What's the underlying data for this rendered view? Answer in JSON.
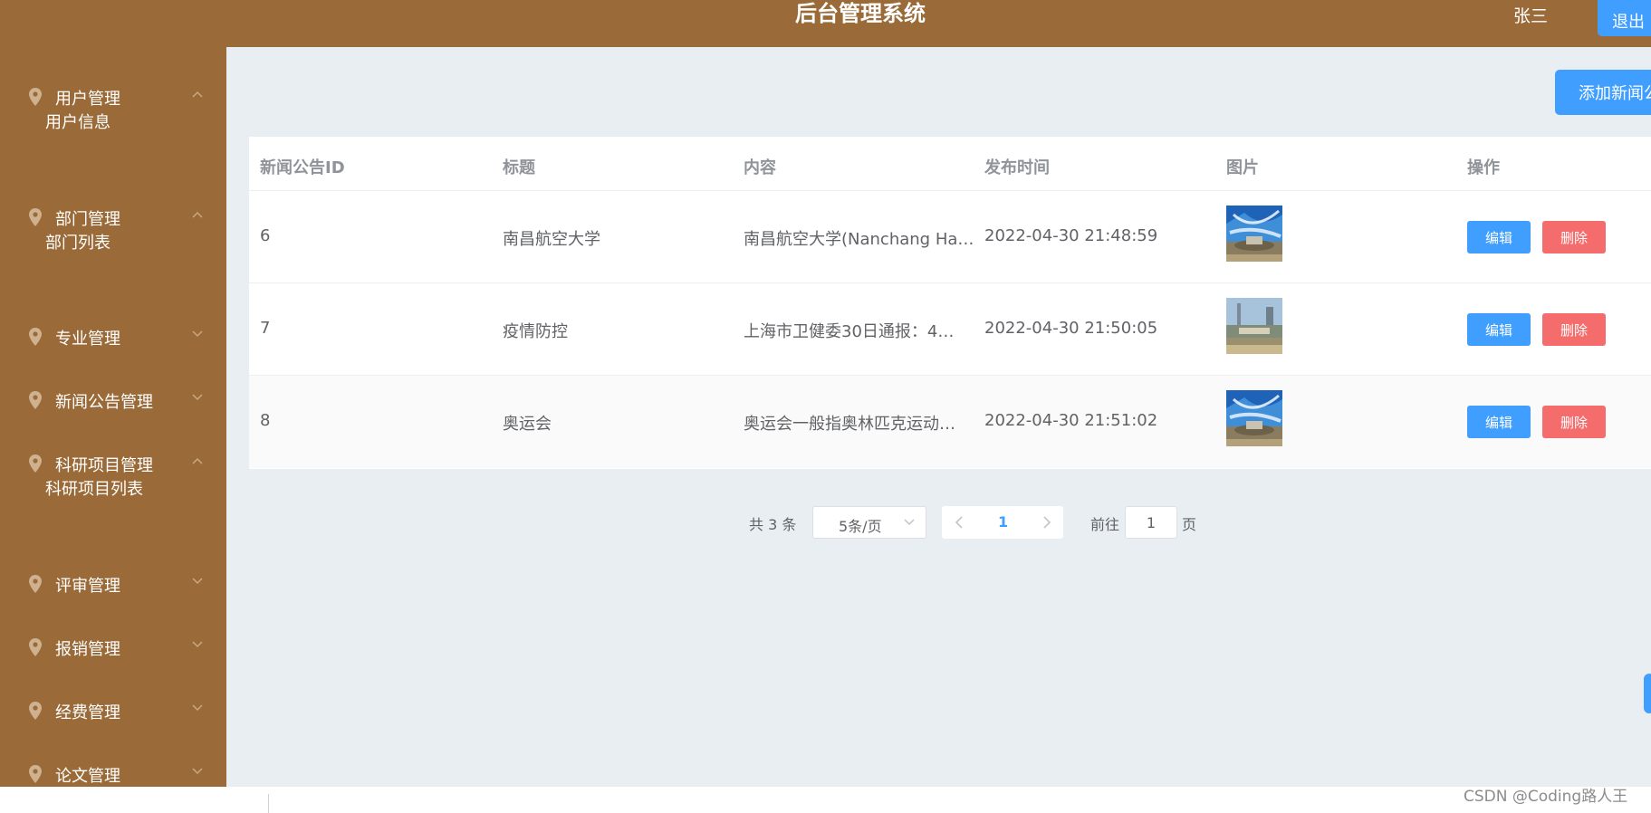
{
  "header": {
    "title": "后台管理系统",
    "user_name": "张三",
    "logout_label": "退出"
  },
  "sidebar": {
    "menus": [
      {
        "label": "用户管理",
        "expanded": true
      },
      {
        "label": "部门管理",
        "expanded": true
      },
      {
        "label": "专业管理",
        "expanded": false
      },
      {
        "label": "新闻公告管理",
        "expanded": false
      },
      {
        "label": "科研项目管理",
        "expanded": true
      },
      {
        "label": "评审管理",
        "expanded": false
      },
      {
        "label": "报销管理",
        "expanded": false
      },
      {
        "label": "经费管理",
        "expanded": false
      },
      {
        "label": "论文管理",
        "expanded": false
      }
    ],
    "sub_items": [
      {
        "label": "用户信息",
        "parent": "用户管理"
      },
      {
        "label": "部门列表",
        "parent": "部门管理"
      },
      {
        "label": "科研项目列表",
        "parent": "科研项目管理"
      }
    ]
  },
  "toolbar": {
    "add_label": "添加新闻公告"
  },
  "table": {
    "columns": [
      "新闻公告ID",
      "标题",
      "内容",
      "发布时间",
      "图片",
      "操作"
    ],
    "rows": [
      {
        "id": "6",
        "title": "南昌航空大学",
        "content": "南昌航空大学(Nanchang Ha…",
        "time": "2022-04-30 21:48:59",
        "image": "campus-photo-1"
      },
      {
        "id": "7",
        "title": "疫情防控",
        "content": "上海市卫健委30日通报：4…",
        "time": "2022-04-30 21:50:05",
        "image": "campus-photo-2"
      },
      {
        "id": "8",
        "title": "奥运会",
        "content": "奥运会一般指奥林匹克运动…",
        "time": "2022-04-30 21:51:02",
        "image": "campus-photo-1"
      }
    ],
    "edit_label": "编辑",
    "delete_label": "删除"
  },
  "pagination": {
    "total_text": "共 3 条",
    "page_size": "5条/页",
    "current_page": "1",
    "goto_label": "前往",
    "goto_value": "1",
    "goto_suffix": "页"
  },
  "watermark": "CSDN @Coding路人王",
  "colors": {
    "sidebar_bg": "#9a6b38",
    "content_bg": "#e9eef3",
    "primary": "#409eff",
    "danger": "#f56c6c"
  }
}
